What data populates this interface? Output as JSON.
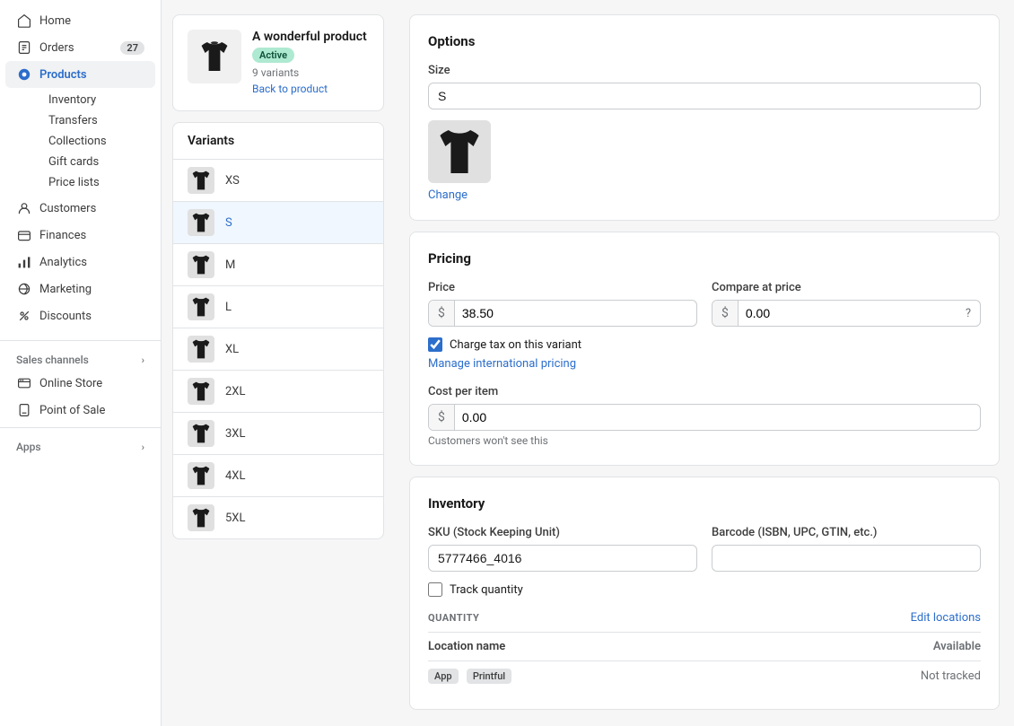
{
  "sidebar": {
    "home_label": "Home",
    "orders_label": "Orders",
    "orders_badge": "27",
    "products_label": "Products",
    "inventory_label": "Inventory",
    "transfers_label": "Transfers",
    "collections_label": "Collections",
    "gift_cards_label": "Gift cards",
    "price_lists_label": "Price lists",
    "customers_label": "Customers",
    "finances_label": "Finances",
    "analytics_label": "Analytics",
    "marketing_label": "Marketing",
    "discounts_label": "Discounts",
    "sales_channels_label": "Sales channels",
    "online_store_label": "Online Store",
    "pos_label": "Point of Sale",
    "apps_label": "Apps"
  },
  "product": {
    "title": "A wonderful product",
    "status": "Active",
    "variants_count": "9 variants",
    "back_link": "Back to product"
  },
  "variants": {
    "section_title": "Variants",
    "items": [
      {
        "name": "XS",
        "selected": false
      },
      {
        "name": "S",
        "selected": true
      },
      {
        "name": "M",
        "selected": false
      },
      {
        "name": "L",
        "selected": false
      },
      {
        "name": "XL",
        "selected": false
      },
      {
        "name": "2XL",
        "selected": false
      },
      {
        "name": "3XL",
        "selected": false
      },
      {
        "name": "4XL",
        "selected": false
      },
      {
        "name": "5XL",
        "selected": false
      }
    ]
  },
  "options": {
    "section_title": "Options",
    "size_label": "Size",
    "size_value": "S",
    "change_label": "Change"
  },
  "pricing": {
    "section_title": "Pricing",
    "price_label": "Price",
    "price_value": "38.50",
    "price_prefix": "$",
    "compare_label": "Compare at price",
    "compare_value": "0.00",
    "compare_prefix": "$",
    "tax_label": "Charge tax on this variant",
    "intl_pricing_link": "Manage international pricing",
    "cost_label": "Cost per item",
    "cost_value": "0.00",
    "cost_prefix": "$",
    "cost_note": "Customers won't see this"
  },
  "inventory": {
    "section_title": "Inventory",
    "sku_label": "SKU (Stock Keeping Unit)",
    "sku_value": "5777466_4016",
    "barcode_label": "Barcode (ISBN, UPC, GTIN, etc.)",
    "barcode_value": "",
    "track_qty_label": "Track quantity",
    "qty_header": "QUANTITY",
    "edit_locations_label": "Edit locations",
    "location_col": "Location name",
    "available_col": "Available",
    "location_tags": [
      "App",
      "Printful"
    ],
    "not_tracked_label": "Not tracked"
  }
}
